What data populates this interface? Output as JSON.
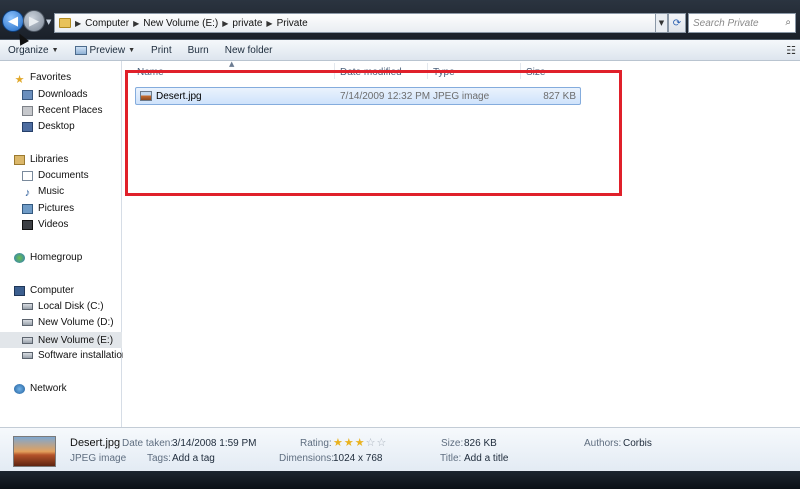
{
  "address": {
    "crumbs": [
      "Computer",
      "New Volume (E:)",
      "private",
      "Private"
    ],
    "search_placeholder": "Search Private"
  },
  "toolbar": {
    "organize": "Organize",
    "preview": "Preview",
    "print": "Print",
    "burn": "Burn",
    "new_folder": "New folder"
  },
  "sidebar": {
    "favorites": "Favorites",
    "downloads": "Downloads",
    "recent_places": "Recent Places",
    "desktop": "Desktop",
    "libraries": "Libraries",
    "documents": "Documents",
    "music": "Music",
    "pictures": "Pictures",
    "videos": "Videos",
    "homegroup": "Homegroup",
    "computer": "Computer",
    "local_disk": "Local Disk (C:)",
    "volume_d": "New Volume (D:)",
    "volume_e": "New Volume (E:)",
    "software": "Software installation",
    "network": "Network"
  },
  "columns": {
    "name": "Name",
    "date_modified": "Date modified",
    "type": "Type",
    "size": "Size"
  },
  "files": [
    {
      "name": "Desert.jpg",
      "date_modified": "7/14/2009 12:32 PM",
      "type": "JPEG image",
      "size": "827 KB"
    }
  ],
  "details": {
    "filename": "Desert.jpg",
    "filetype": "JPEG image",
    "date_taken_label": "Date taken:",
    "date_taken": "3/14/2008 1:59 PM",
    "tags_label": "Tags:",
    "tags": "Add a tag",
    "rating_label": "Rating:",
    "rating": 3,
    "rating_max": 5,
    "dimensions_label": "Dimensions:",
    "dimensions": "1024 x 768",
    "size_label": "Size:",
    "size": "826 KB",
    "title_label": "Title:",
    "title": "Add a title",
    "authors_label": "Authors:",
    "authors": "Corbis"
  },
  "colors": {
    "highlight_box": "#e0202a",
    "selection": "#cfe3fb",
    "star_on": "#e9b21f"
  }
}
